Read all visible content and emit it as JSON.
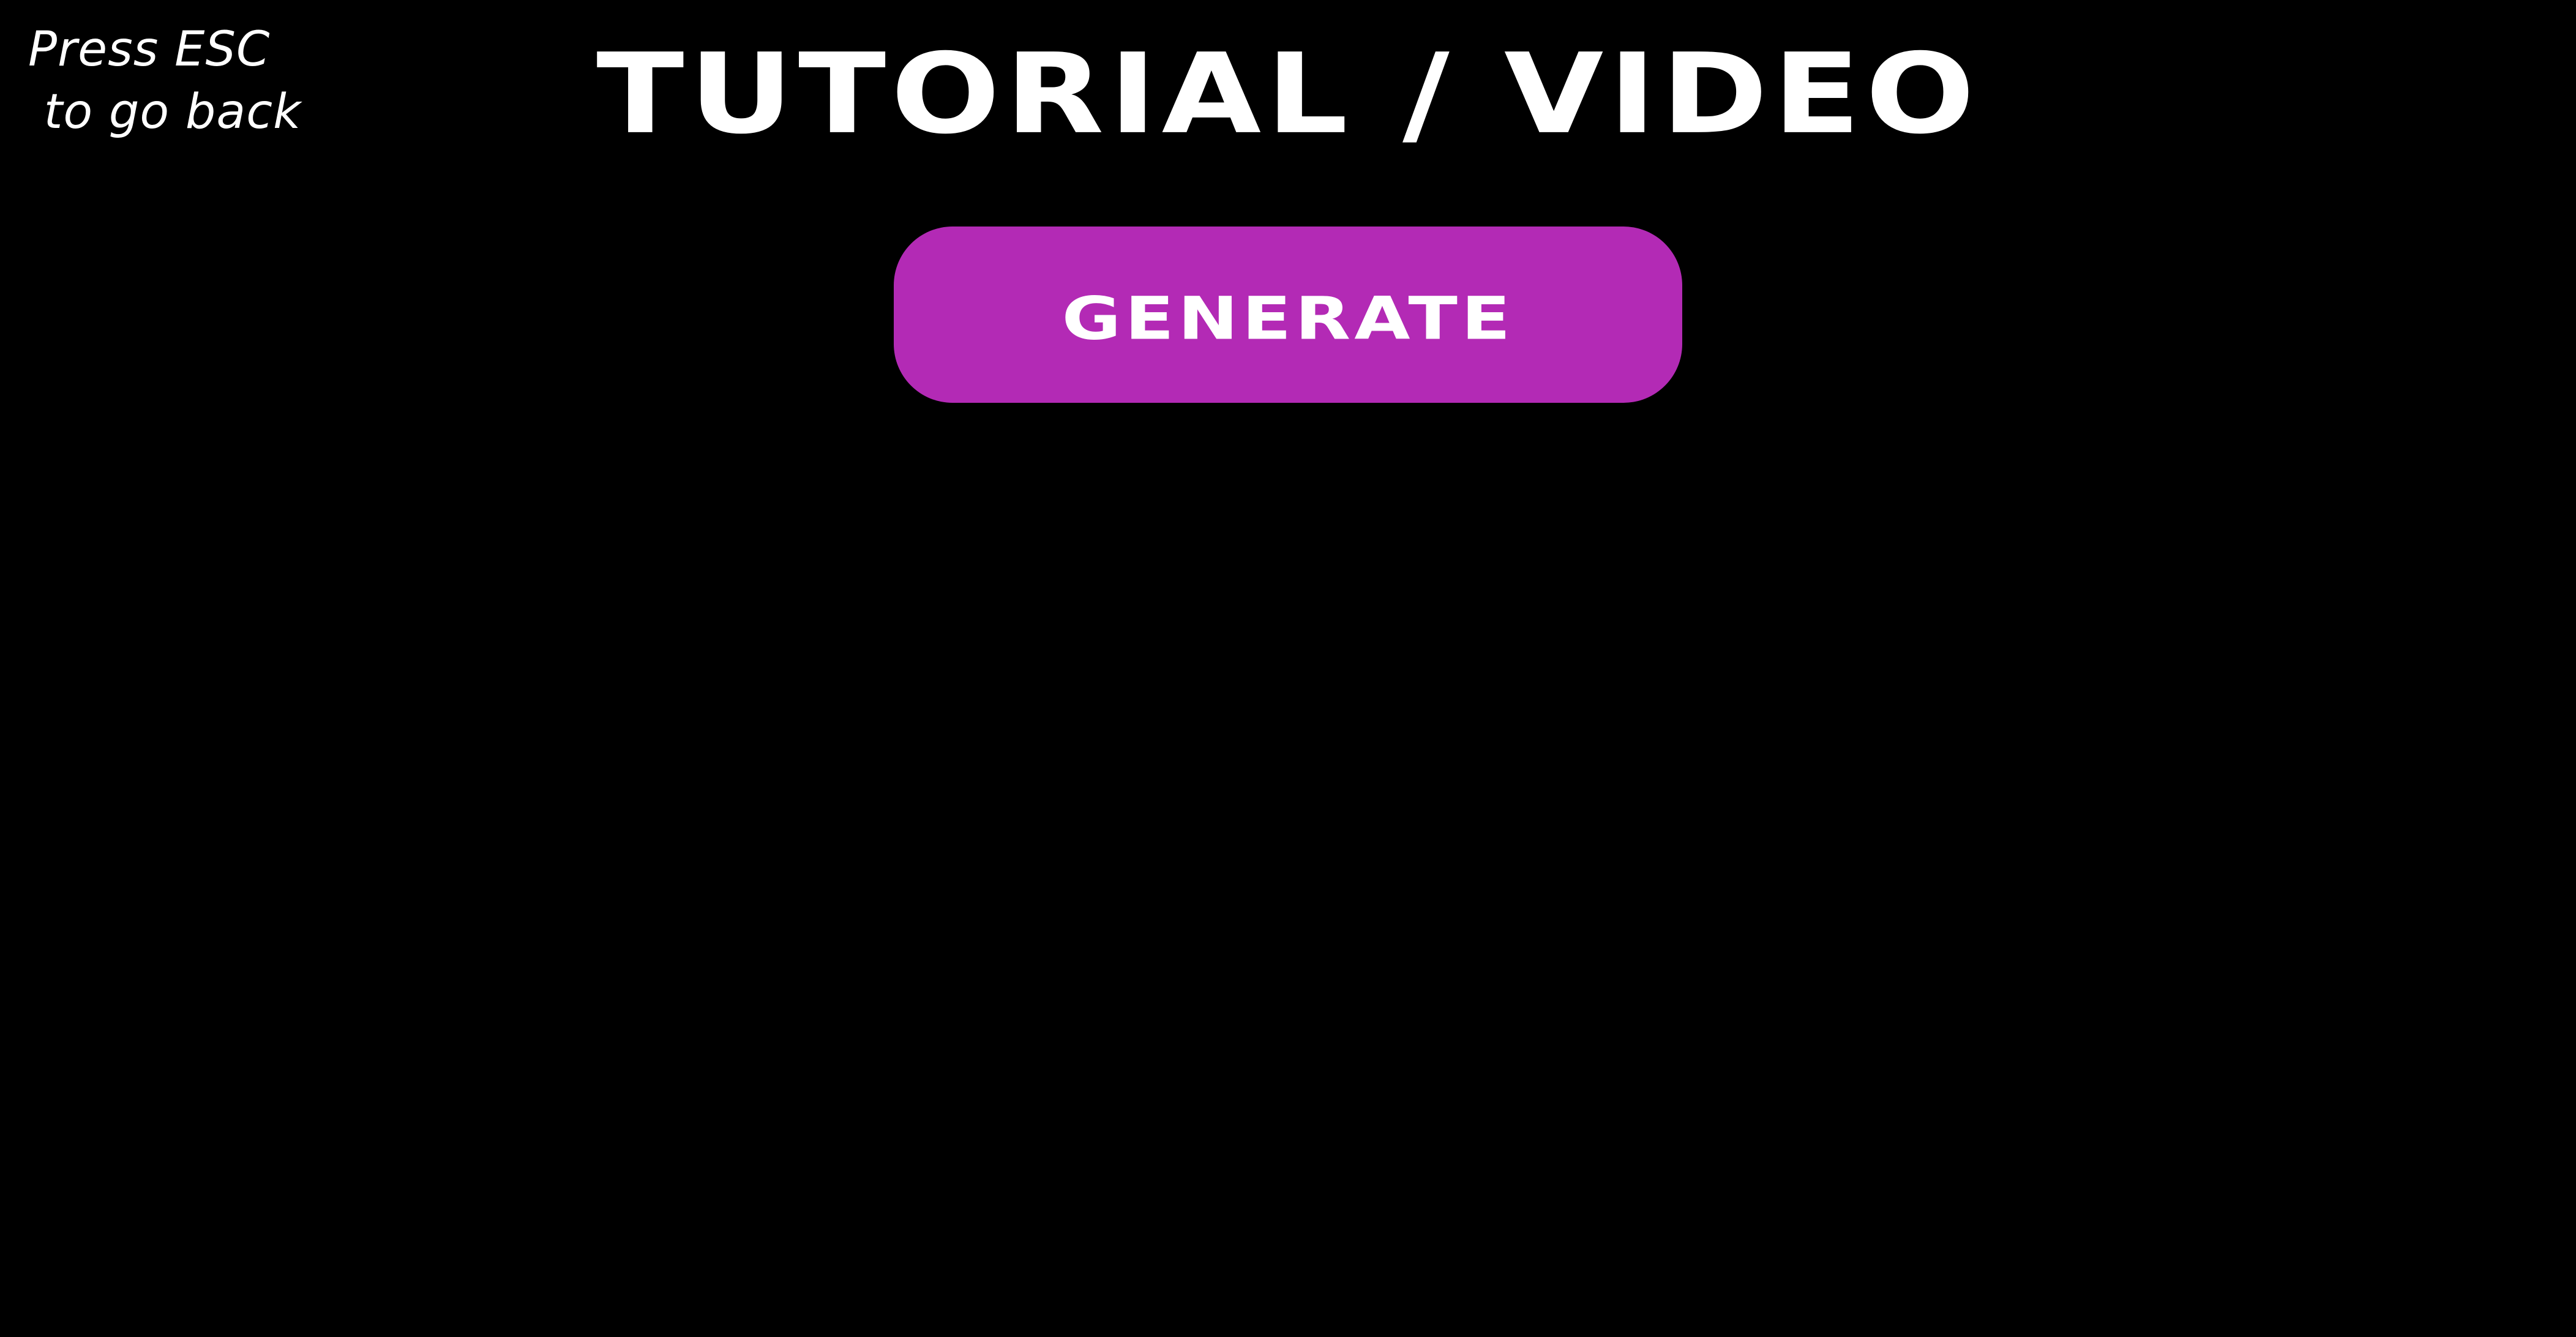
{
  "esc_hint": {
    "line1": "Press ESC",
    "line2": " to go back"
  },
  "title": "TUTORIAL / VIDEO",
  "generate_button": {
    "label": "GENERATE",
    "color": "#b32ab5"
  },
  "colors": {
    "background": "#000000",
    "text": "#ffffff"
  }
}
